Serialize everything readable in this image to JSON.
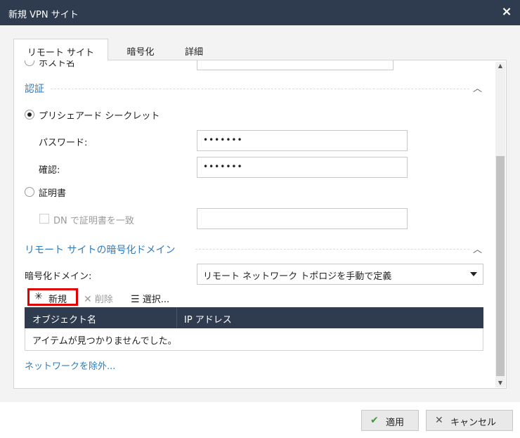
{
  "window": {
    "title": "新規 VPN サイト",
    "close_glyph": "×"
  },
  "tabs": [
    {
      "label": "リモート サイト",
      "active": true
    },
    {
      "label": "暗号化",
      "active": false
    },
    {
      "label": "詳細",
      "active": false
    }
  ],
  "top_partial": {
    "host_label": "ホスト名"
  },
  "auth": {
    "title": "認証",
    "preshared_label": "プリシェアード シークレット",
    "password_label": "パスワード:",
    "password_value": "•••••••",
    "confirm_label": "確認:",
    "confirm_value": "•••••••",
    "certificate_label": "証明書",
    "dn_label": "DN で証明書を一致"
  },
  "domain": {
    "title": "リモート サイトの暗号化ドメイン",
    "domain_label": "暗号化ドメイン:",
    "domain_selected": "リモート ネットワーク トポロジを手動で定義",
    "toolbar": {
      "new": "新規",
      "delete": "削除",
      "select": "選択..."
    },
    "table": {
      "columns": [
        "オブジェクト名",
        "IP アドレス"
      ],
      "empty_message": "アイテムが見つかりませんでした。"
    },
    "exclude_link": "ネットワークを除外..."
  },
  "footer": {
    "apply": "適用",
    "cancel": "キャンセル"
  },
  "colors": {
    "titlebar": "#2f3b4e",
    "accent": "#2f7bbd",
    "highlight": "#e00000",
    "apply_check": "#3c9a3c"
  }
}
